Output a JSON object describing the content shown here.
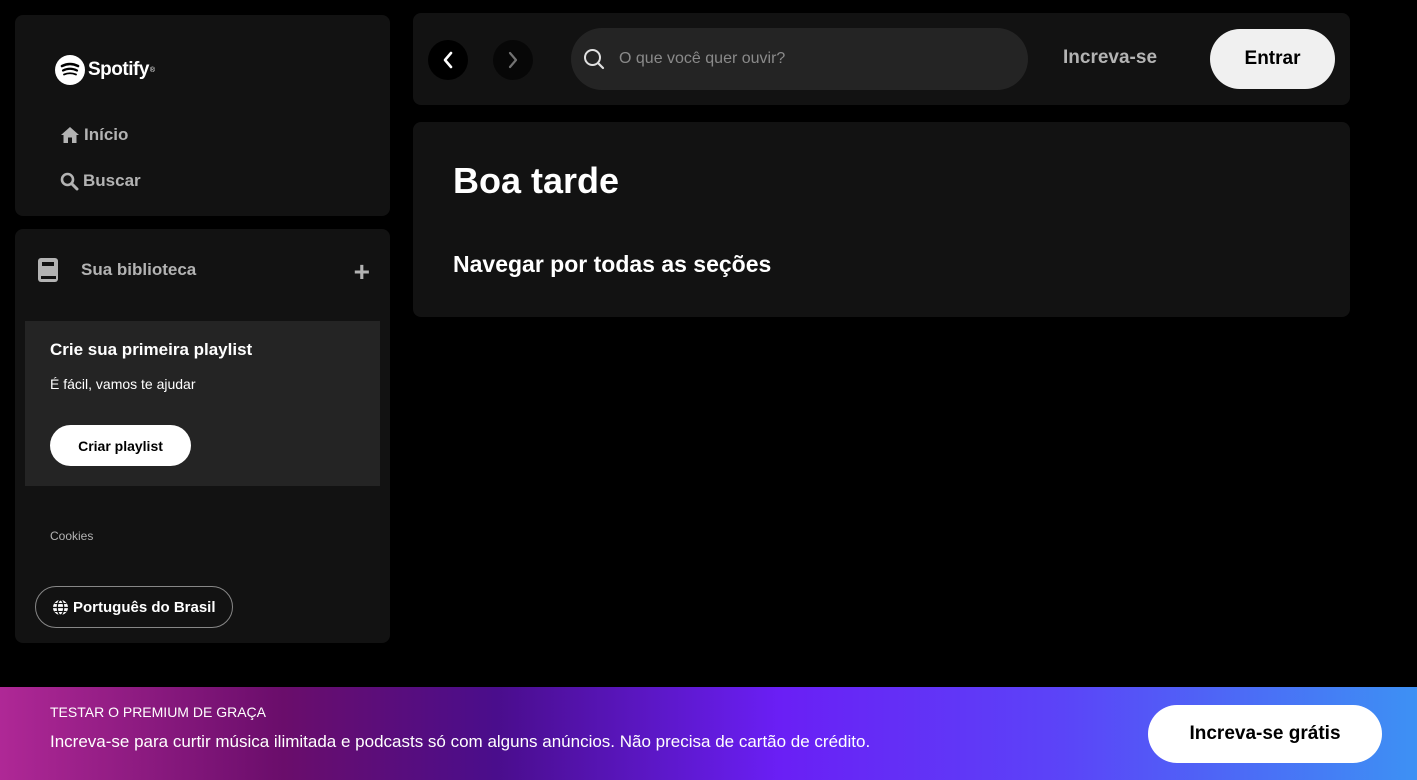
{
  "sidebar": {
    "logo_text": "Spotify",
    "logo_mark": "®",
    "nav": [
      {
        "label": "Início",
        "icon": "home-icon"
      },
      {
        "label": "Buscar",
        "icon": "search-icon"
      }
    ]
  },
  "library": {
    "title": "Sua biblioteca",
    "add_label": "+",
    "card": {
      "title": "Crie sua primeira playlist",
      "subtitle": "É fácil, vamos te ajudar",
      "button": "Criar playlist"
    },
    "cookies": "Cookies",
    "language": "Português do Brasil"
  },
  "header": {
    "search_placeholder": "O que você quer ouvir?",
    "signup": "Increva-se",
    "login": "Entrar"
  },
  "main": {
    "greeting": "Boa tarde",
    "section": "Navegar por todas as seções"
  },
  "banner": {
    "title": "TESTAR O PREMIUM DE GRAÇA",
    "text": "Increva-se para curtir música ilimitada e podcasts só com alguns anúncios. Não precisa de cartão de crédito.",
    "button": "Increva-se grátis"
  }
}
